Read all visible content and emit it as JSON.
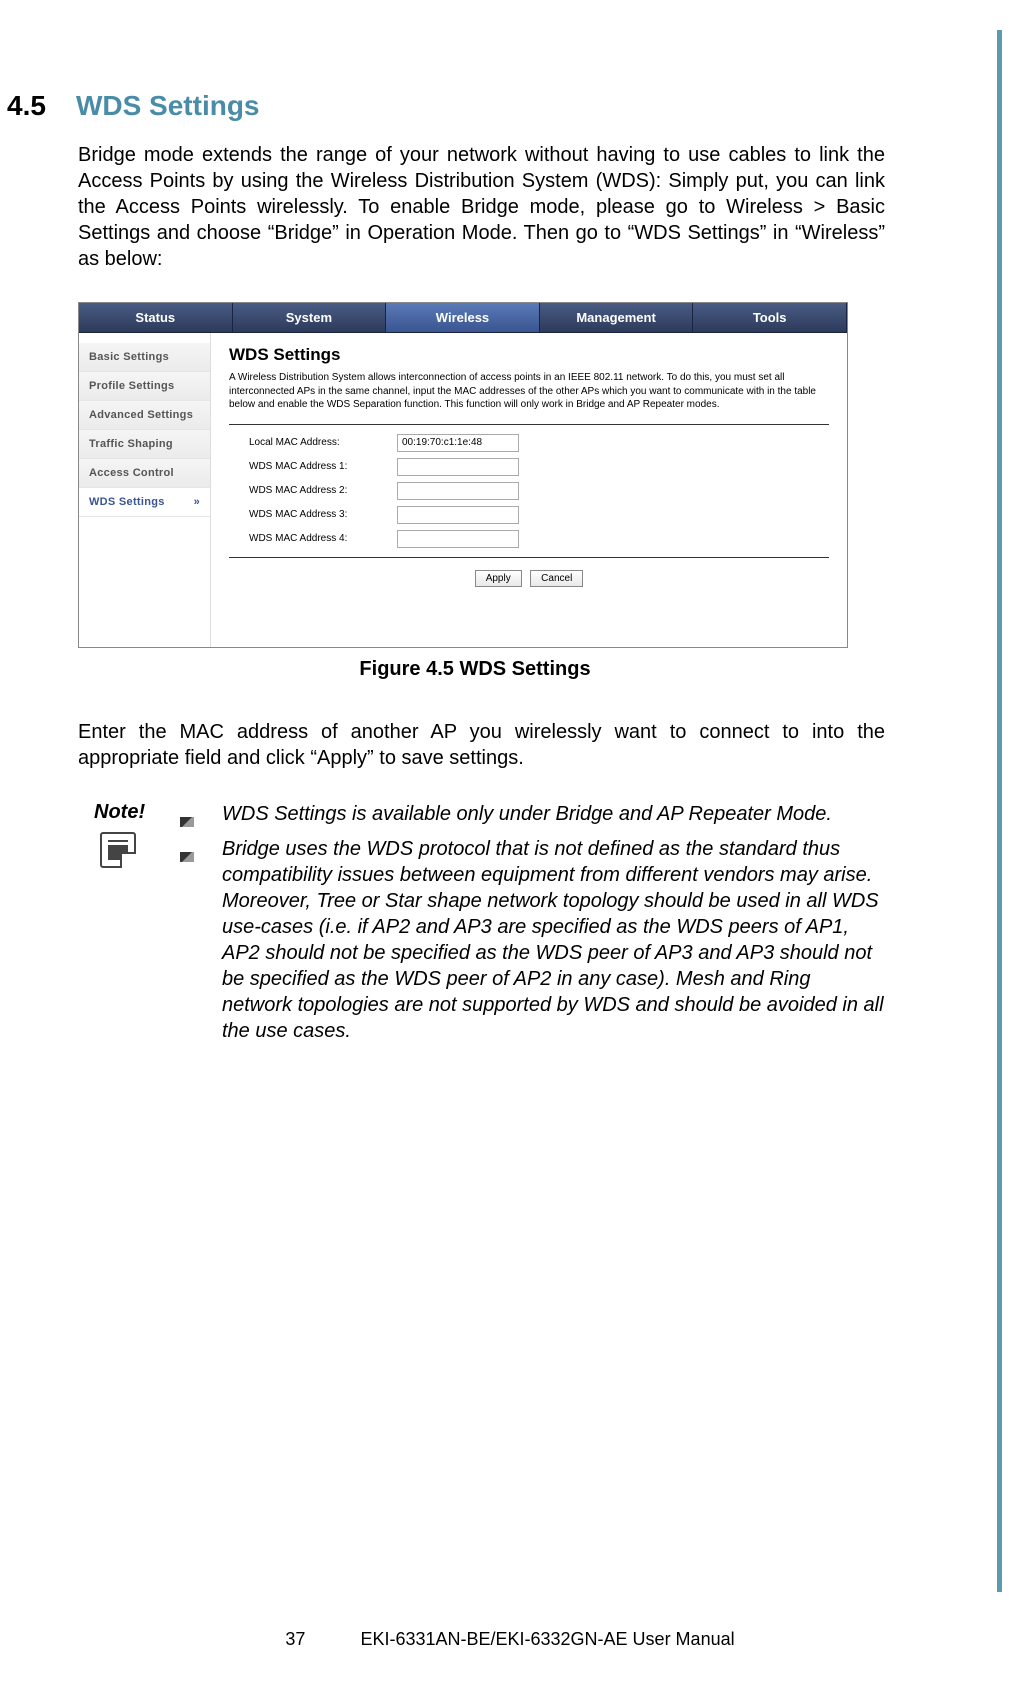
{
  "section": {
    "number": "4.5",
    "title": "WDS Settings"
  },
  "intro": "Bridge mode extends the range of your network without having to use cables to link the Access Points by using the Wireless Distribution System (WDS): Simply put, you can link the Access Points wirelessly. To enable Bridge mode, please go to Wireless > Basic Settings and choose “Bridge” in Operation Mode.  Then go to “WDS Settings” in “Wireless” as below:",
  "screenshot": {
    "tabs": [
      "Status",
      "System",
      "Wireless",
      "Management",
      "Tools"
    ],
    "sidebar": [
      "Basic Settings",
      "Profile Settings",
      "Advanced Settings",
      "Traffic Shaping",
      "Access Control",
      "WDS Settings"
    ],
    "sidebar_chev": "»",
    "panel_title": "WDS Settings",
    "panel_desc": "A Wireless Distribution System allows interconnection of access points in an IEEE 802.11 network. To do this, you must set all interconnected APs in the same channel, input the MAC addresses of the other APs which you want to communicate with in the table below and enable the WDS Separation function. This function will only work in Bridge and AP Repeater modes.",
    "fields": {
      "local_label": "Local MAC Address:",
      "local_value": "00:19:70:c1:1e:48",
      "mac1_label": "WDS MAC Address 1:",
      "mac1_value": "",
      "mac2_label": "WDS MAC Address 2:",
      "mac2_value": "",
      "mac3_label": "WDS MAC Address 3:",
      "mac3_value": "",
      "mac4_label": "WDS MAC Address 4:",
      "mac4_value": ""
    },
    "apply_btn": "Apply",
    "cancel_btn": "Cancel"
  },
  "figure_caption": "Figure 4.5 WDS Settings",
  "post_text": "Enter the MAC address of another AP you wirelessly want to connect to into the appropriate field and click “Apply” to save settings.",
  "note": {
    "label": "Note!",
    "items": [
      "WDS Settings is available only under Bridge and AP Repeater Mode.",
      "Bridge uses the WDS protocol that is not defined as the standard thus compatibility issues between equipment from different vendors may arise.  Moreover, Tree or Star shape network topology should be used in all WDS use-cases (i.e. if AP2 and AP3 are specified as the WDS peers of AP1, AP2 should not be specified as the WDS peer of AP3 and AP3 should not be specified as the WDS peer of AP2 in any case). Mesh and Ring network topologies are not supported by WDS and should be avoided in all the use cases."
    ]
  },
  "footer": {
    "page": "37",
    "manual": "EKI-6331AN-BE/EKI-6332GN-AE User Manual"
  }
}
